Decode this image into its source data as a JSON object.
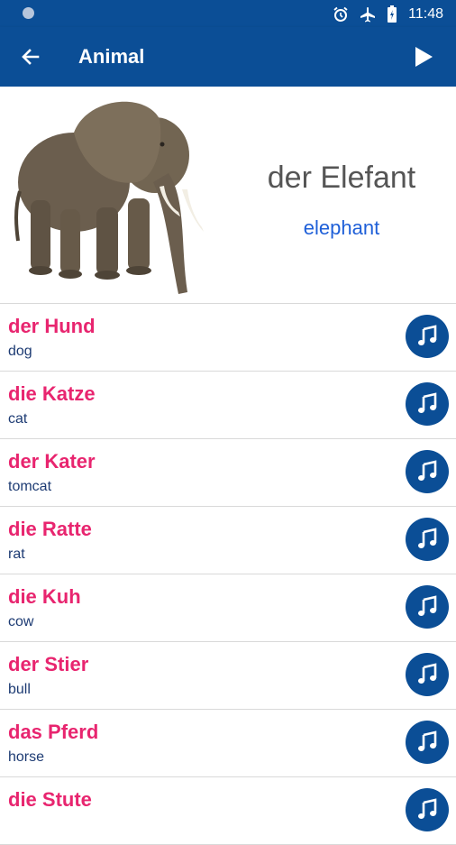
{
  "status_bar": {
    "time": "11:48"
  },
  "app_bar": {
    "title": "Animal"
  },
  "hero": {
    "word": "der Elefant",
    "translation": "elephant"
  },
  "items": [
    {
      "word": "der Hund",
      "translation": "dog"
    },
    {
      "word": "die Katze",
      "translation": "cat"
    },
    {
      "word": "der Kater",
      "translation": "tomcat"
    },
    {
      "word": "die Ratte",
      "translation": "rat"
    },
    {
      "word": "die Kuh",
      "translation": "cow"
    },
    {
      "word": "der Stier",
      "translation": "bull"
    },
    {
      "word": "das Pferd",
      "translation": "horse"
    },
    {
      "word": "die Stute",
      "translation": ""
    }
  ],
  "colors": {
    "primary": "#0b4e96",
    "word": "#e8256f",
    "translation": "#1d3b73",
    "hero_translation": "#1e5fd8"
  },
  "icons": [
    "back-arrow-icon",
    "play-icon",
    "music-note-icon",
    "alarm-icon",
    "airplane-icon",
    "battery-icon"
  ]
}
